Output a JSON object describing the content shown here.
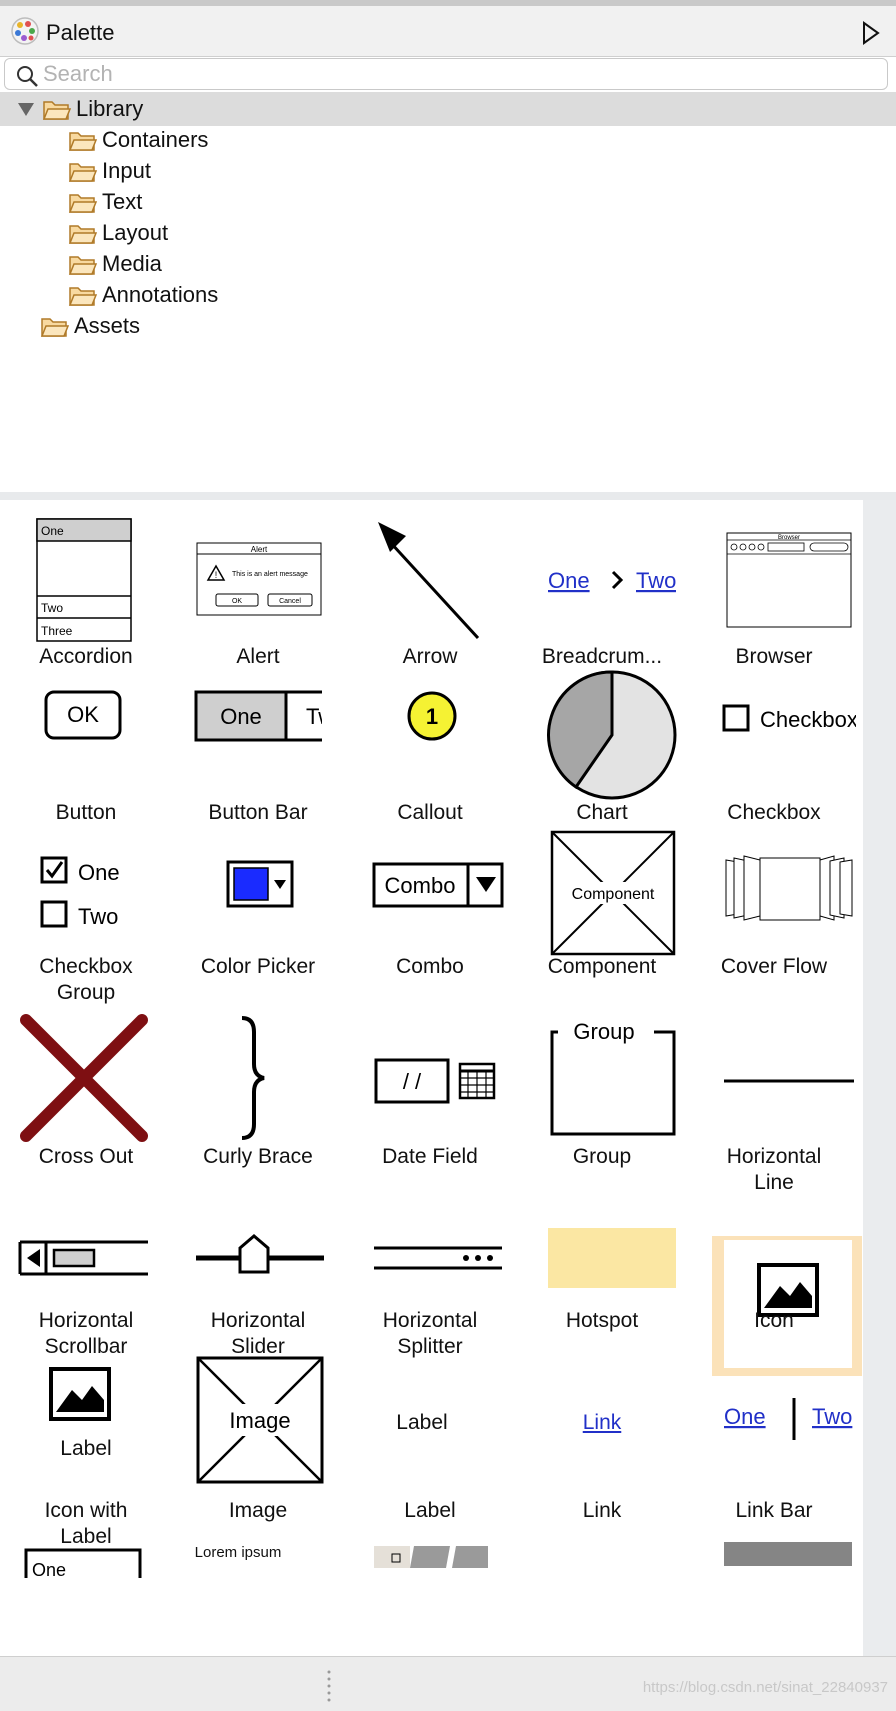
{
  "panel": {
    "title": "Palette"
  },
  "search": {
    "placeholder": "Search"
  },
  "tree": {
    "library": "Library",
    "children": [
      "Containers",
      "Input",
      "Text",
      "Layout",
      "Media",
      "Annotations"
    ],
    "assets": "Assets"
  },
  "components": [
    {
      "label": "Accordion",
      "accordion": [
        "One",
        "Two",
        "Three"
      ]
    },
    {
      "label": "Alert",
      "alert_title": "Alert",
      "alert_msg": "This is an alert message",
      "alert_ok": "OK",
      "alert_cancel": "Cancel"
    },
    {
      "label": "Arrow"
    },
    {
      "label": "Breadcrum...",
      "crumb1": "One",
      "crumb2": "Two"
    },
    {
      "label": "Browser",
      "browser_title": "Browser"
    },
    {
      "label": "Button",
      "button_text": "OK"
    },
    {
      "label": "Button Bar",
      "bar1": "One",
      "bar2": "Two"
    },
    {
      "label": "Callout",
      "callout_num": "1"
    },
    {
      "label": "Chart"
    },
    {
      "label": "Checkbox",
      "checkbox_text": "Checkbox"
    },
    {
      "label": "Checkbox\nGroup",
      "cb1": "One",
      "cb2": "Two"
    },
    {
      "label": "Color Picker"
    },
    {
      "label": "Combo",
      "combo_text": "Combo"
    },
    {
      "label": "Component",
      "component_text": "Component"
    },
    {
      "label": "Cover Flow"
    },
    {
      "label": "Cross Out"
    },
    {
      "label": "Curly Brace"
    },
    {
      "label": "Date Field",
      "date_text": "/ /"
    },
    {
      "label": "Group",
      "group_text": "Group"
    },
    {
      "label": "Horizontal\nLine"
    },
    {
      "label": "Horizontal\nScrollbar"
    },
    {
      "label": "Horizontal\nSlider"
    },
    {
      "label": "Horizontal\nSplitter"
    },
    {
      "label": "Hotspot"
    },
    {
      "label": "Icon"
    },
    {
      "label": "Icon with\nLabel",
      "icon_label": "Label"
    },
    {
      "label": "Image",
      "image_text": "Image"
    },
    {
      "label": "Label",
      "label_preview": "Label"
    },
    {
      "label": "Link",
      "link_preview": "Link"
    },
    {
      "label": "Link Bar",
      "lb1": "One",
      "lb2": "Two"
    },
    {
      "lorem": "Lorem ipsum",
      "list_one": "One"
    }
  ],
  "colors": {
    "selected_bg": "#fbe2b9",
    "link": "#2130c8",
    "cross": "#7e0f12",
    "callout": "#f5f233",
    "color_swatch": "#1a2bff",
    "hotspot": "#fbe7a3"
  },
  "status": {
    "watermark": "https://blog.csdn.net/sinat_22840937"
  }
}
